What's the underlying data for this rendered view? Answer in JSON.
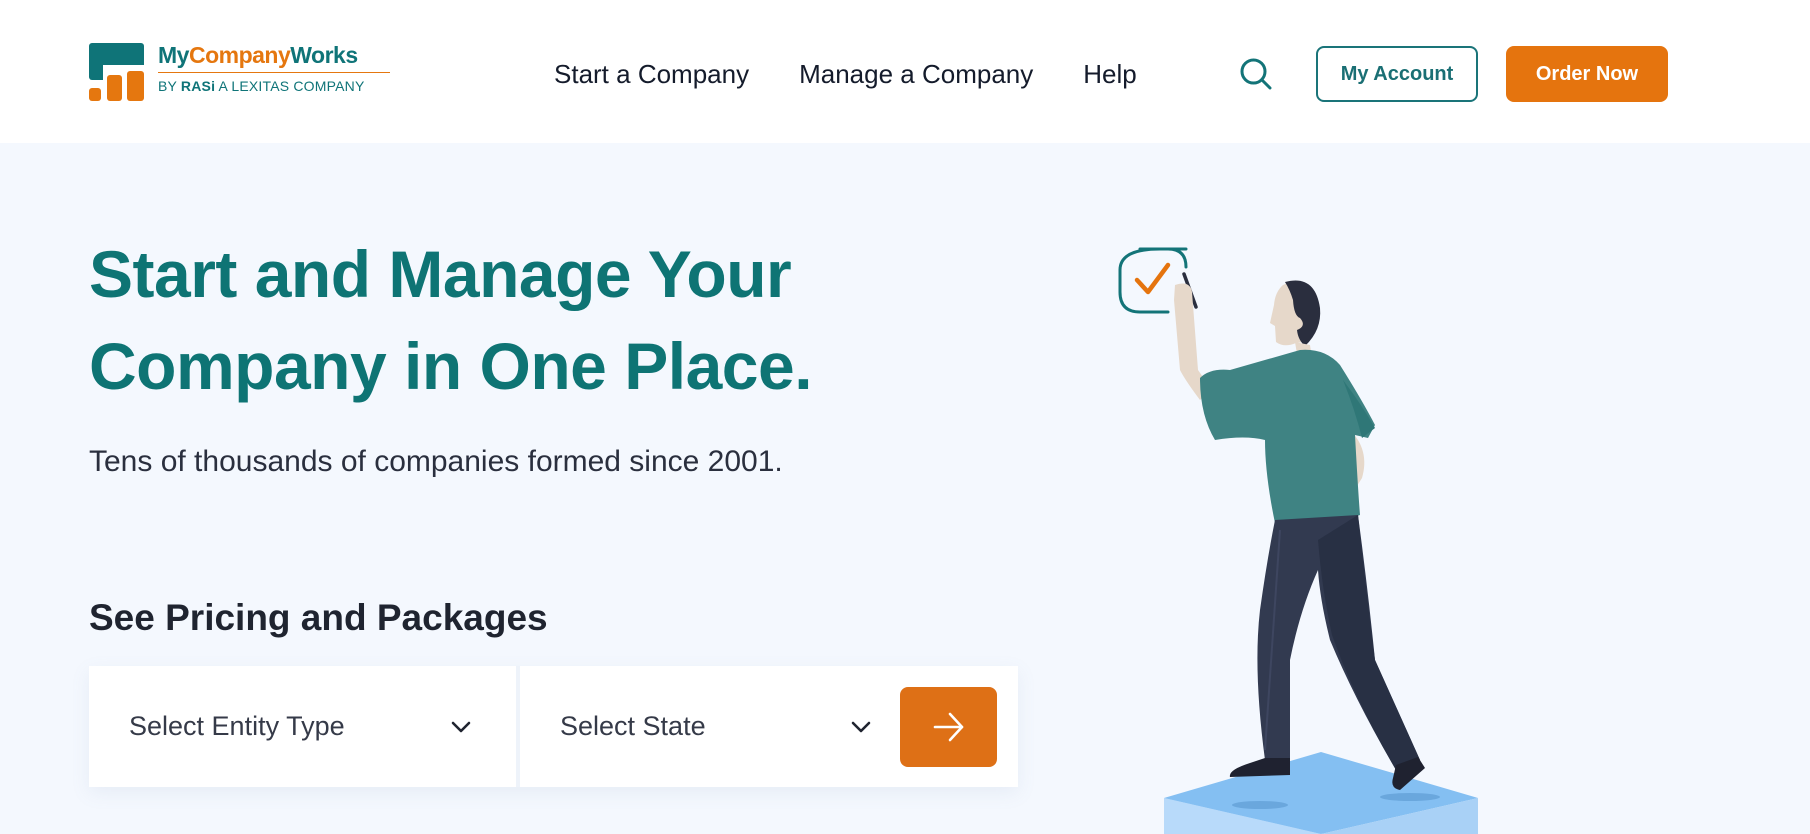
{
  "header": {
    "logo": {
      "name_part1": "My",
      "name_part2": "Company",
      "name_part3": "Works",
      "tagline_prefix": "BY ",
      "tagline_brand": "RASi",
      "tagline_suffix": " A LEXITAS COMPANY"
    },
    "nav": [
      {
        "label": "Start a Company"
      },
      {
        "label": "Manage a Company"
      },
      {
        "label": "Help"
      }
    ],
    "search_icon": "search-icon",
    "my_account_label": "My Account",
    "order_now_label": "Order Now"
  },
  "hero": {
    "title_line1": "Start and Manage Your",
    "title_line2": "Company in One Place.",
    "subtitle": "Tens of thousands of companies formed since 2001."
  },
  "pricing": {
    "title": "See Pricing and Packages",
    "entity_select": {
      "selected": "Select Entity Type",
      "icon": "chevron-down-icon"
    },
    "state_select": {
      "selected": "Select State",
      "icon": "chevron-down-icon"
    },
    "go_button_icon": "arrow-right-icon"
  },
  "illustration": {
    "description": "person-checking-checkbox-illustration"
  },
  "colors": {
    "brand_teal": "#0f7478",
    "brand_orange": "#e5740e",
    "page_bg": "#f4f8fe",
    "header_bg": "#ffffff",
    "heading_dark": "#1f2430"
  }
}
